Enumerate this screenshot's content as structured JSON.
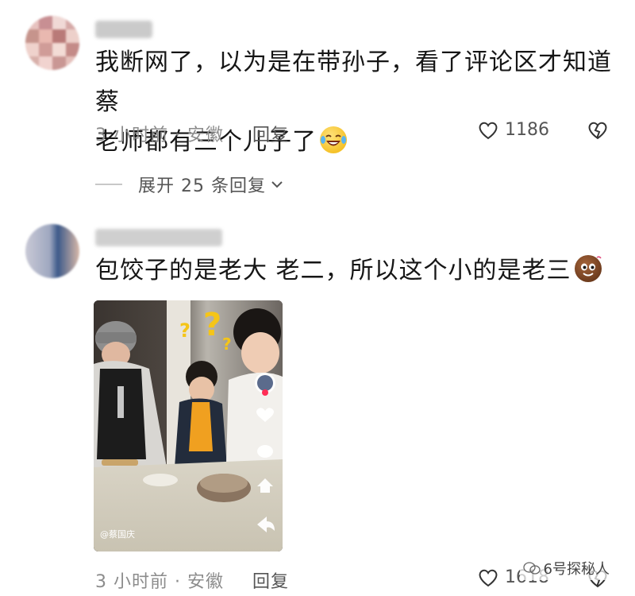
{
  "comments": [
    {
      "text_line1": "我断网了，以为是在带孙子，看了评论区才知道蔡",
      "text_line2": "老师都有三个儿子了",
      "emoji_icon": "laughing-tears-emoji",
      "time_location": "3 小时前 · 安徽",
      "reply_label": "回复",
      "likes": "1186"
    },
    {
      "text": "包饺子的是老大 老二，所以这个小的是老三",
      "emoji_icon": "poop-emoji",
      "time_location": "3 小时前 · 安徽",
      "reply_label": "回复",
      "likes": "1618"
    }
  ],
  "expand_label": "展开 25 条回复",
  "video": {
    "author": "@蔡国庆"
  },
  "watermark": "6号探秘人",
  "colors": {
    "text": "#161616",
    "meta": "#8c8c8c",
    "secondary": "#555555"
  }
}
